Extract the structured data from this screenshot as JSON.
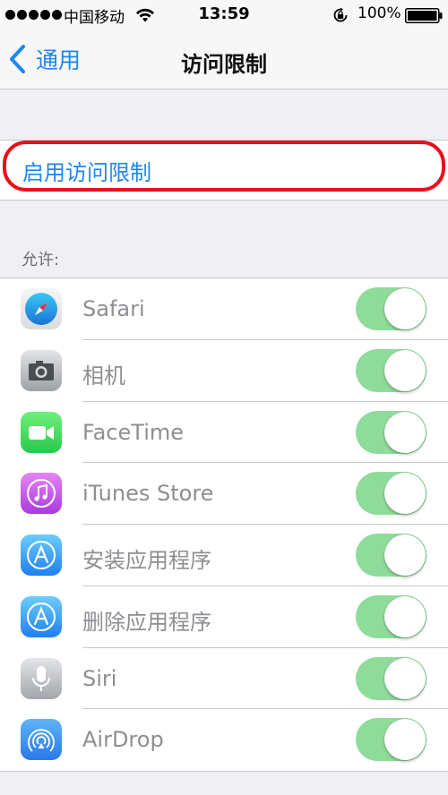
{
  "status_bar": {
    "carrier": "中国移动",
    "time": "13:59",
    "battery": "100%",
    "signal_icon": "signal-dots-icon",
    "wifi_icon": "wifi-icon",
    "lock_icon": "orientation-lock-icon",
    "battery_icon": "battery-icon"
  },
  "nav": {
    "back_label": "通用",
    "title": "访问限制"
  },
  "enable": {
    "label": "启用访问限制",
    "highlight_color": "#e8101b"
  },
  "allow_section": {
    "header": "允许:",
    "items": [
      {
        "label": "Safari",
        "icon": "safari-icon",
        "enabled": true
      },
      {
        "label": "相机",
        "icon": "camera-icon",
        "enabled": true
      },
      {
        "label": "FaceTime",
        "icon": "facetime-icon",
        "enabled": true
      },
      {
        "label": "iTunes Store",
        "icon": "itunes-store-icon",
        "enabled": true
      },
      {
        "label": "安装应用程序",
        "icon": "app-store-icon",
        "enabled": true
      },
      {
        "label": "删除应用程序",
        "icon": "app-store-icon",
        "enabled": true
      },
      {
        "label": "Siri",
        "icon": "siri-icon",
        "enabled": true
      },
      {
        "label": "AirDrop",
        "icon": "airdrop-icon",
        "enabled": true
      }
    ]
  },
  "colors": {
    "accent": "#1f86ee",
    "toggle_on": "#8fdc9a",
    "background": "#efeff4"
  }
}
